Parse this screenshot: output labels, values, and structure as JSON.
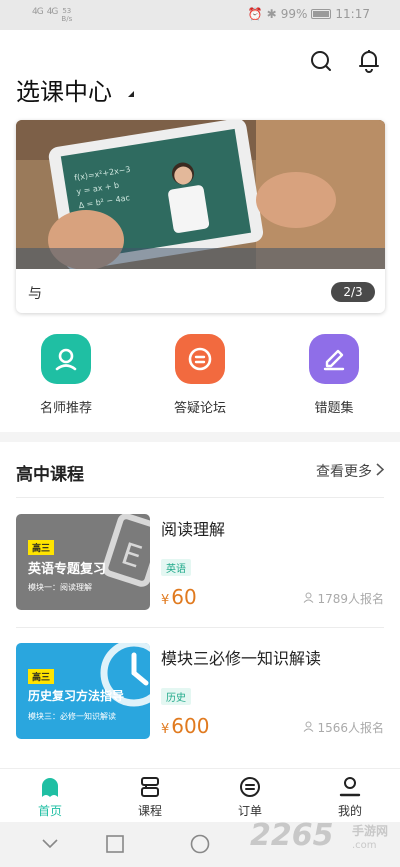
{
  "status_bar": {
    "signal_1": "4G",
    "signal_2": "4G",
    "net_speed": "53",
    "net_unit": "B/s",
    "battery": "99%",
    "time": "11:17"
  },
  "header": {
    "title": "选课中心",
    "icons": [
      "search-icon",
      "bell-icon"
    ]
  },
  "banner": {
    "caption": "与",
    "counter": "2/3"
  },
  "quick_actions": [
    {
      "label": "名师推荐",
      "icon": "teacher-icon",
      "color": "#1fbfa3"
    },
    {
      "label": "答疑论坛",
      "icon": "chat-icon",
      "color": "#f26a3f"
    },
    {
      "label": "错题集",
      "icon": "pencil-icon",
      "color": "#8f6ee8"
    }
  ],
  "section": {
    "title": "高中课程",
    "more": "查看更多"
  },
  "courses": [
    {
      "title": "阅读理解",
      "tag": "英语",
      "price_symbol": "¥",
      "price": "60",
      "enroll": "1789人报名",
      "thumb": {
        "grade": "高三",
        "title": "英语专题复习",
        "sub": "模块一：阅读理解",
        "color": "#7b7b7b"
      }
    },
    {
      "title": "模块三必修一知识解读",
      "tag": "历史",
      "price_symbol": "¥",
      "price": "600",
      "enroll": "1566人报名",
      "thumb": {
        "grade": "高三",
        "title": "历史复习方法指导",
        "sub": "模块三：必修一知识解读",
        "color": "#2aa6de"
      }
    }
  ],
  "tabs": [
    {
      "label": "首页",
      "icon": "home-icon",
      "active": true
    },
    {
      "label": "课程",
      "icon": "course-icon",
      "active": false
    },
    {
      "label": "订单",
      "icon": "order-icon",
      "active": false
    },
    {
      "label": "我的",
      "icon": "profile-icon",
      "active": false
    }
  ],
  "watermark": {
    "brand": "2265",
    "sub": "手游网",
    "url": ".com"
  },
  "colors": {
    "accent": "#1fbfa3",
    "price": "#e07a1f"
  }
}
